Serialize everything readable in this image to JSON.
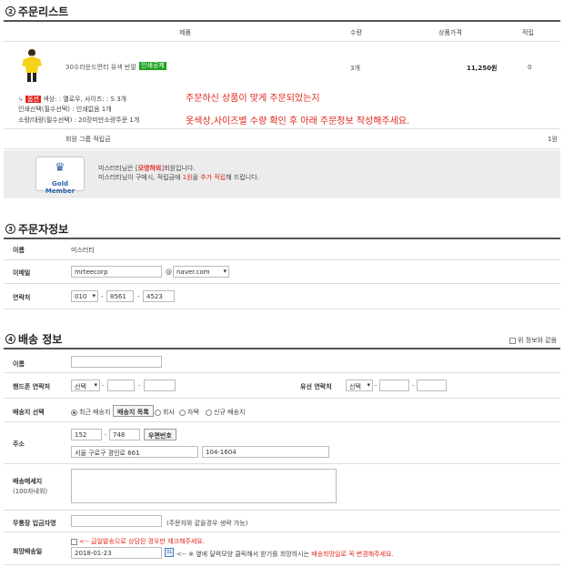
{
  "order_list": {
    "number": "2",
    "title": "주문리스트",
    "col_product": "제품",
    "col_qty": "수량",
    "col_price": "상품가격",
    "col_point": "적립",
    "product_name": "30수라운드면티 유색 반팔",
    "product_badge": "인쇄공제",
    "qty": "3개",
    "price": "11,250원",
    "point": "0",
    "option_badge": "옵션",
    "option_line1": "색상: : 옐로우, 사이즈: : S 3개",
    "option_line2": "인쇄선택(필수선택) : 인쇄없음 1개",
    "option_line3": "소량/대량(필수선택) : 20장미만소량주문 1개",
    "notice_line1": "주문하신 상품이 맞게 주문되었는지",
    "notice_line2": "옷색상,사이즈별 수량 확인 후 아래 주문정보 작성해주세요.",
    "group_point_label": "회원 그룹 적립금",
    "group_point_value": "1원",
    "member_badge": "Gold Member",
    "member_line1_pre": "미스터티님은 [",
    "member_grade": "모영하외",
    "member_line1_post": "]회원입니다.",
    "member_line2_pre": "미스터티님이 구매시, 적립금에 ",
    "member_rate": "1원",
    "member_line2_mid": "을 ",
    "member_extra": "추가 적립",
    "member_line2_post": "해 드립니다."
  },
  "orderer": {
    "number": "3",
    "title": "주문자정보",
    "name_label": "이름",
    "name_value": "미스터티",
    "email_label": "이메일",
    "email_id": "mrteecorp",
    "email_at": "@",
    "email_domain": "naver.com",
    "phone_label": "연락처",
    "phone1": "010",
    "phone2": "8561",
    "phone3": "4523",
    "dash": "-"
  },
  "shipping": {
    "number": "4",
    "title": "배송 정보",
    "same_as_above": "위 정보와 같음",
    "name_label": "이름",
    "mobile_label": "핸드폰 연락처",
    "select_placeholder": "선택",
    "landline_label": "유선 연락처",
    "dest_label": "배송지 선택",
    "dest_recent": "최근 배송지",
    "dest_list_button": "배송지 목록",
    "dest_company": "회사",
    "dest_home": "자택",
    "dest_new": "신규 배송지",
    "address_label": "주소",
    "zip1": "152",
    "zip2": "748",
    "zip_button": "우편번호",
    "address1": "서울 구로구 경인로 661",
    "address2": "104-1604",
    "message_label": "배송메세지",
    "message_sub": "(100자내외)",
    "print_name_label": "무통장 입금자명",
    "print_name_hint": "(주문자와 같을경우 생략 가능)",
    "desired_date_label": "희망배송일",
    "urgent_text": "<-- 급일발송으로 상담된 경우만 체크해주세요.",
    "desired_date": "2018-01-23",
    "calendar_icon_text": "31",
    "date_hint_pre": "<-- ※ 옆에 달력모양 클릭해서 받기를 희망하시는 ",
    "date_hint_red": "배송희망일로 꼭 변경해주세요."
  }
}
